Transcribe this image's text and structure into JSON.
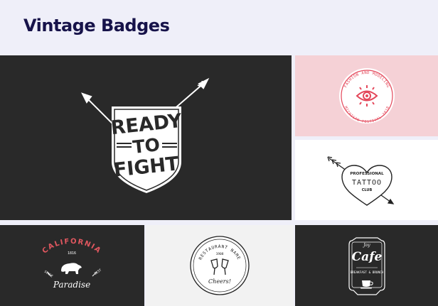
{
  "page": {
    "title": "Vintage Badges"
  },
  "badges": {
    "ready_to_fight": {
      "line1": "READY",
      "line2": "TO",
      "line3": "FIGHT"
    },
    "fashion": {
      "top_arc": "FASHION AND MODELING",
      "bottom_arc": "MICHIGAN FESTIVAL 2018"
    },
    "tattoo": {
      "line1": "PROFESSIONAL",
      "line2": "TATTOO",
      "line3": "CLUB"
    },
    "california": {
      "arc": "CALIFORNIA",
      "est": "1816",
      "left_small": "SINCE",
      "right_small": "BEST",
      "script": "Paradise"
    },
    "restaurant": {
      "arc": "RESTAURANT NAME",
      "year": "1908",
      "script": "Cheers!"
    },
    "cafe": {
      "script_top": "Joy",
      "name": "Cafe",
      "sub": "BREAKFAST & BRUNCH"
    }
  },
  "colors": {
    "title": "#17134a",
    "dark_tile": "#292929",
    "pink_tile": "#f5d1d6",
    "badge_red": "#e4475a",
    "cal_red": "#e0575f"
  }
}
